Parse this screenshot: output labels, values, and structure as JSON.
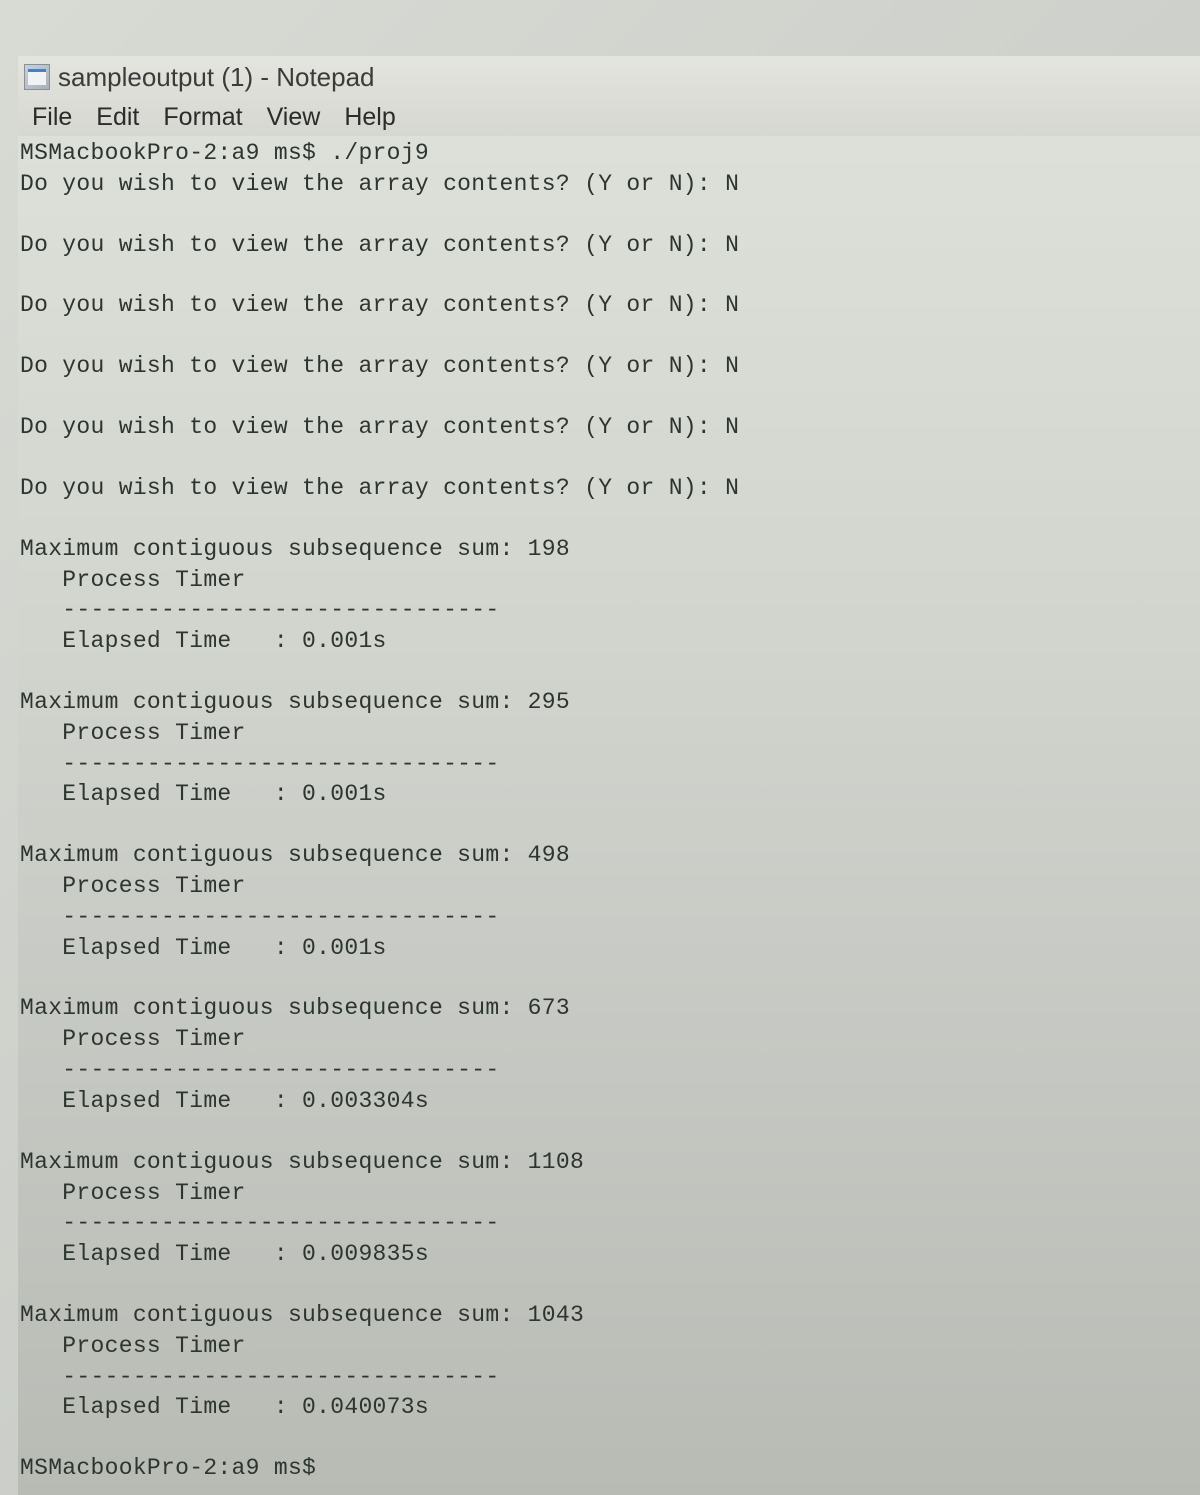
{
  "window": {
    "title": "sampleoutput (1) - Notepad"
  },
  "menu": {
    "file": "File",
    "edit": "Edit",
    "format": "Format",
    "view": "View",
    "help": "Help"
  },
  "content": {
    "lines": [
      "MSMacbookPro-2:a9 ms$ ./proj9",
      "Do you wish to view the array contents? (Y or N): N",
      "",
      "Do you wish to view the array contents? (Y or N): N",
      "",
      "Do you wish to view the array contents? (Y or N): N",
      "",
      "Do you wish to view the array contents? (Y or N): N",
      "",
      "Do you wish to view the array contents? (Y or N): N",
      "",
      "Do you wish to view the array contents? (Y or N): N",
      "",
      "Maximum contiguous subsequence sum: 198",
      "   Process Timer",
      "   -------------------------------",
      "   Elapsed Time   : 0.001s",
      "",
      "Maximum contiguous subsequence sum: 295",
      "   Process Timer",
      "   -------------------------------",
      "   Elapsed Time   : 0.001s",
      "",
      "Maximum contiguous subsequence sum: 498",
      "   Process Timer",
      "   -------------------------------",
      "   Elapsed Time   : 0.001s",
      "",
      "Maximum contiguous subsequence sum: 673",
      "   Process Timer",
      "   -------------------------------",
      "   Elapsed Time   : 0.003304s",
      "",
      "Maximum contiguous subsequence sum: 1108",
      "   Process Timer",
      "   -------------------------------",
      "   Elapsed Time   : 0.009835s",
      "",
      "Maximum contiguous subsequence sum: 1043",
      "   Process Timer",
      "   -------------------------------",
      "   Elapsed Time   : 0.040073s",
      "",
      "MSMacbookPro-2:a9 ms$"
    ]
  }
}
